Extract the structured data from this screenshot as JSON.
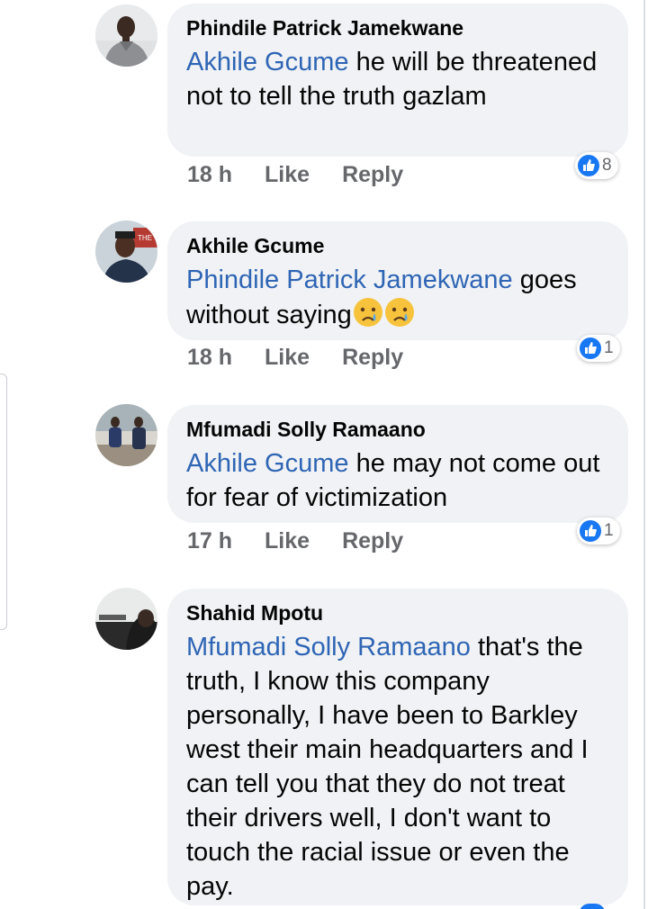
{
  "colors": {
    "bubble": "#f0f2f5",
    "mention": "#2e65b5",
    "meta": "#65676b",
    "like_badge": "#1877f2"
  },
  "comments": [
    {
      "author": "Phindile Patrick Jamekwane",
      "mention": "Akhile Gcume",
      "text": " he will be threatened not to tell the truth gazlam",
      "emoji": "",
      "time": "18 h",
      "like_label": "Like",
      "reply_label": "Reply",
      "reaction_icon": "thumbs-up-icon",
      "reaction_count": "8"
    },
    {
      "author": "Akhile Gcume",
      "mention": "Phindile Patrick Jamekwane",
      "text": " goes without saying",
      "emoji": "crying-face-icon x2",
      "time": "18 h",
      "like_label": "Like",
      "reply_label": "Reply",
      "reaction_icon": "thumbs-up-icon",
      "reaction_count": "1"
    },
    {
      "author": "Mfumadi Solly Ramaano",
      "mention": "Akhile Gcume",
      "text": " he may not come out for fear of victimization",
      "emoji": "",
      "time": "17 h",
      "like_label": "Like",
      "reply_label": "Reply",
      "reaction_icon": "thumbs-up-icon",
      "reaction_count": "1"
    },
    {
      "author": "Shahid Mpotu",
      "mention": "Mfumadi Solly Ramaano",
      "text": " that's the truth, I know this company personally, I have been to Barkley west their main headquarters and I can tell you that they do not treat their drivers well, I don't want to touch the racial issue or even the pay.",
      "emoji": "",
      "time": "",
      "like_label": "",
      "reply_label": "",
      "reaction_icon": "",
      "reaction_count": ""
    }
  ]
}
